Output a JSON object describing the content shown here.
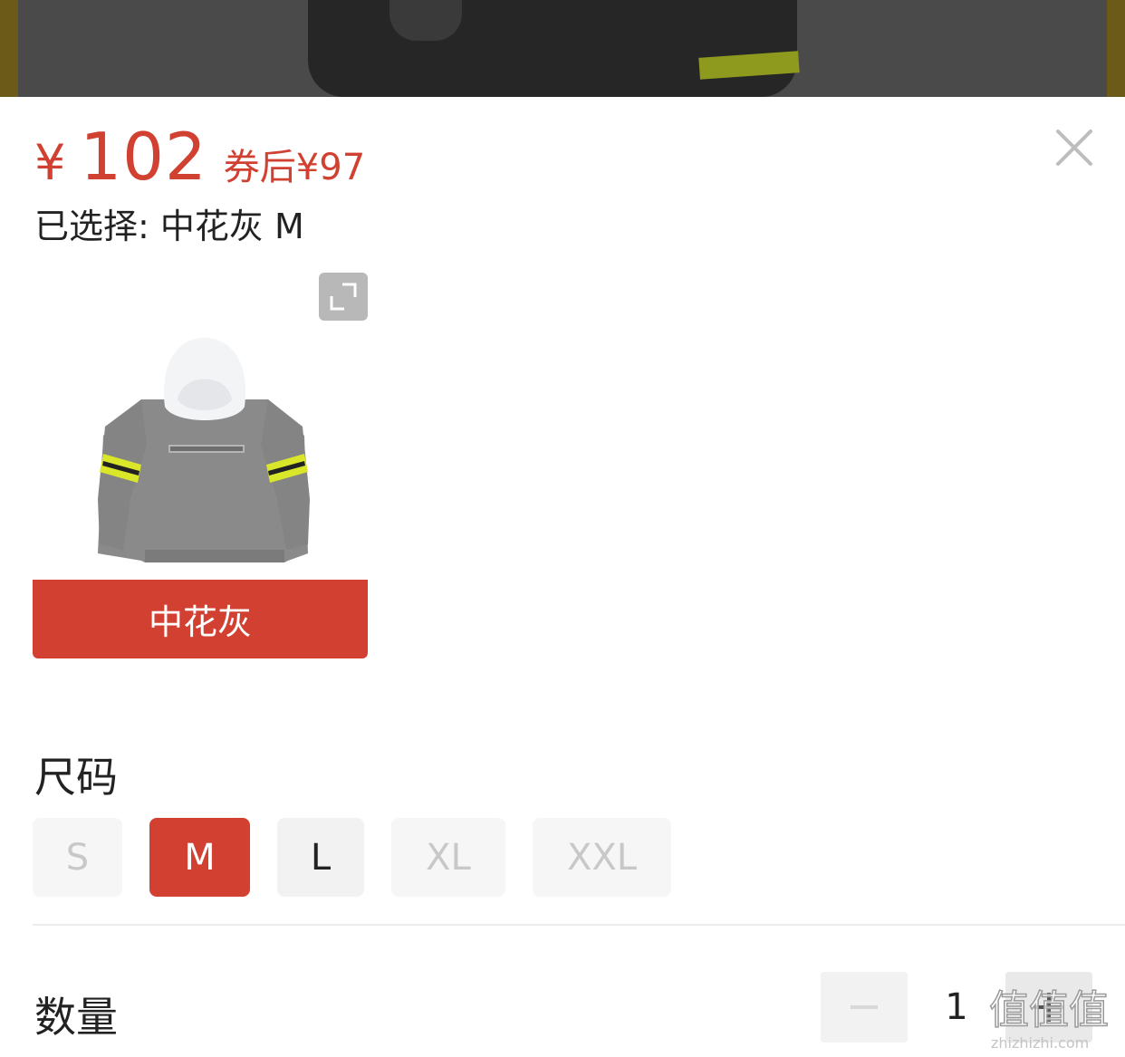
{
  "pricing": {
    "currency_symbol": "¥",
    "price": "102",
    "coupon_label": "券后¥97",
    "accent_color": "#d14132"
  },
  "selection": {
    "summary": "已选择: 中花灰 M"
  },
  "color_options": [
    {
      "label": "中花灰",
      "selected": true,
      "thumbnail": "gray-hoodie-with-white-hood-and-yellow-sleeve-stripes"
    }
  ],
  "size": {
    "title": "尺码",
    "options": [
      {
        "label": "S",
        "state": "disabled"
      },
      {
        "label": "M",
        "state": "selected"
      },
      {
        "label": "L",
        "state": "available"
      },
      {
        "label": "XL",
        "state": "disabled"
      },
      {
        "label": "XXL",
        "state": "disabled"
      }
    ]
  },
  "quantity": {
    "title": "数量",
    "value": "1"
  },
  "icons": {
    "close": "close-icon",
    "expand": "expand-icon",
    "minus": "minus-icon",
    "plus": "plus-icon"
  },
  "watermark": {
    "text": "值值值",
    "url_text": "zhizhizhi.com"
  }
}
